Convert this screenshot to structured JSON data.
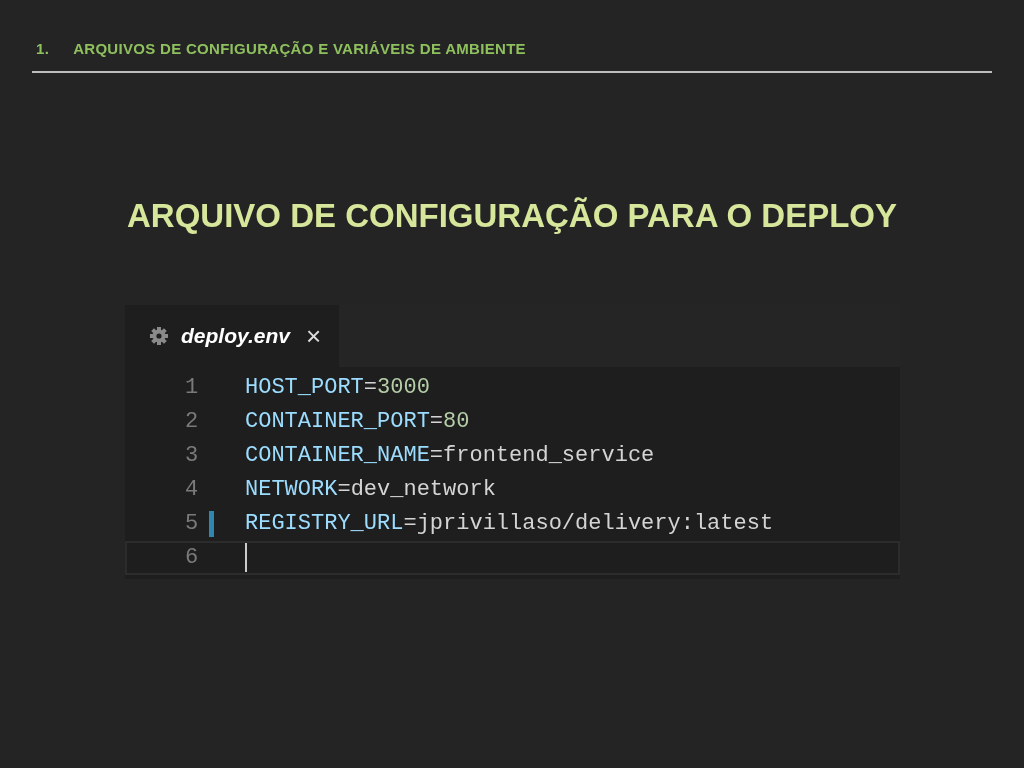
{
  "header": {
    "number": "1.",
    "title": "ARQUIVOS DE CONFIGURAÇÃO E VARIÁVEIS DE AMBIENTE"
  },
  "slide_title": "ARQUIVO DE CONFIGURAÇÃO PARA O DEPLOY",
  "editor": {
    "tab": {
      "label": "deploy.env",
      "close": "×",
      "selected": true
    },
    "lines": [
      {
        "number": "1",
        "key": "HOST_PORT",
        "sep": "=",
        "value": "3000",
        "kind": "number",
        "modified": false,
        "current": false
      },
      {
        "number": "2",
        "key": "CONTAINER_PORT",
        "sep": "=",
        "value": "80",
        "kind": "number",
        "modified": false,
        "current": false
      },
      {
        "number": "3",
        "key": "CONTAINER_NAME",
        "sep": "=",
        "value": "frontend_service",
        "kind": "string",
        "modified": false,
        "current": false
      },
      {
        "number": "4",
        "key": "NETWORK",
        "sep": "=",
        "value": "dev_network",
        "kind": "string",
        "modified": false,
        "current": false
      },
      {
        "number": "5",
        "key": "REGISTRY_URL",
        "sep": "=",
        "value": "jprivillaso/delivery:latest",
        "kind": "string",
        "modified": true,
        "current": false
      },
      {
        "number": "6",
        "kind": "empty",
        "modified": false,
        "current": true
      }
    ]
  }
}
